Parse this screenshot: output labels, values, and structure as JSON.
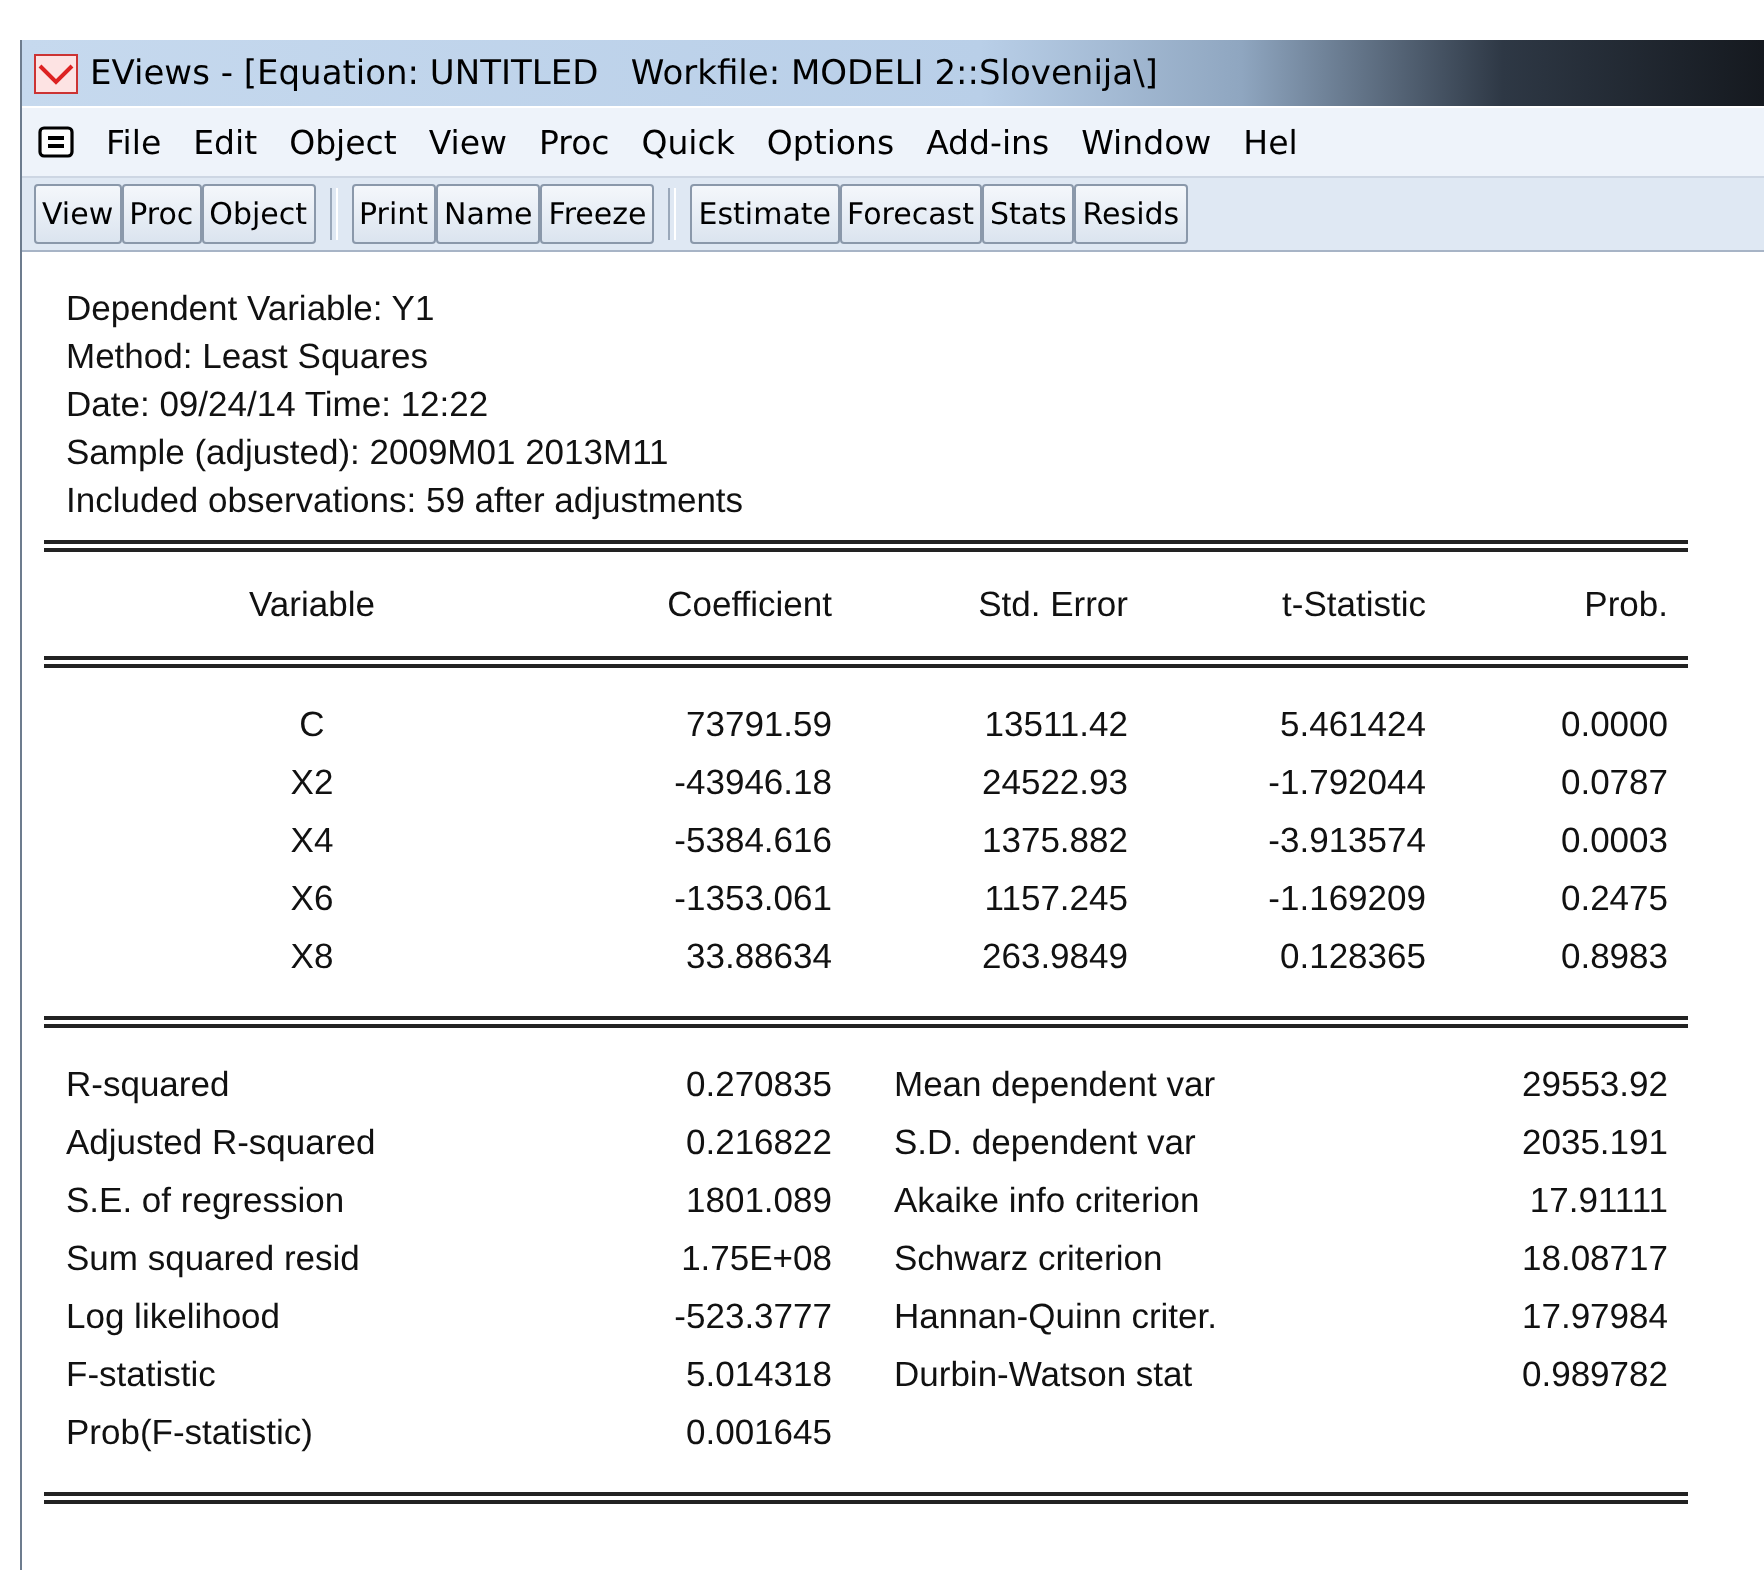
{
  "window": {
    "title": "EViews - [Equation: UNTITLED   Workfile: MODELI 2::Slovenija\\]"
  },
  "menu": [
    "File",
    "Edit",
    "Object",
    "View",
    "Proc",
    "Quick",
    "Options",
    "Add-ins",
    "Window",
    "Hel"
  ],
  "toolbar": [
    [
      "View",
      "Proc",
      "Object"
    ],
    [
      "Print",
      "Name",
      "Freeze"
    ],
    [
      "Estimate",
      "Forecast",
      "Stats",
      "Resids"
    ]
  ],
  "header_lines": [
    "Dependent Variable: Y1",
    "Method: Least Squares",
    "Date: 09/24/14   Time: 12:22",
    "Sample (adjusted): 2009M01 2013M11",
    "Included observations: 59 after adjustments"
  ],
  "table": {
    "columns": [
      "Variable",
      "Coefficient",
      "Std. Error",
      "t-Statistic",
      "Prob."
    ],
    "rows": [
      [
        "C",
        "73791.59",
        "13511.42",
        "5.461424",
        "0.0000"
      ],
      [
        "X2",
        "-43946.18",
        "24522.93",
        "-1.792044",
        "0.0787"
      ],
      [
        "X4",
        "-5384.616",
        "1375.882",
        "-3.913574",
        "0.0003"
      ],
      [
        "X6",
        "-1353.061",
        "1157.245",
        "-1.169209",
        "0.2475"
      ],
      [
        "X8",
        "33.88634",
        "263.9849",
        "0.128365",
        "0.8983"
      ]
    ]
  },
  "statistics": [
    [
      "R-squared",
      "0.270835",
      "Mean dependent var",
      "29553.92"
    ],
    [
      "Adjusted R-squared",
      "0.216822",
      "S.D. dependent var",
      "2035.191"
    ],
    [
      "S.E. of regression",
      "1801.089",
      "Akaike info criterion",
      "17.91111"
    ],
    [
      "Sum squared resid",
      "1.75E+08",
      "Schwarz criterion",
      "18.08717"
    ],
    [
      "Log likelihood",
      "-523.3777",
      "Hannan-Quinn criter.",
      "17.97984"
    ],
    [
      "F-statistic",
      "5.014318",
      "Durbin-Watson stat",
      "0.989782"
    ],
    [
      "Prob(F-statistic)",
      "0.001645"
    ]
  ]
}
